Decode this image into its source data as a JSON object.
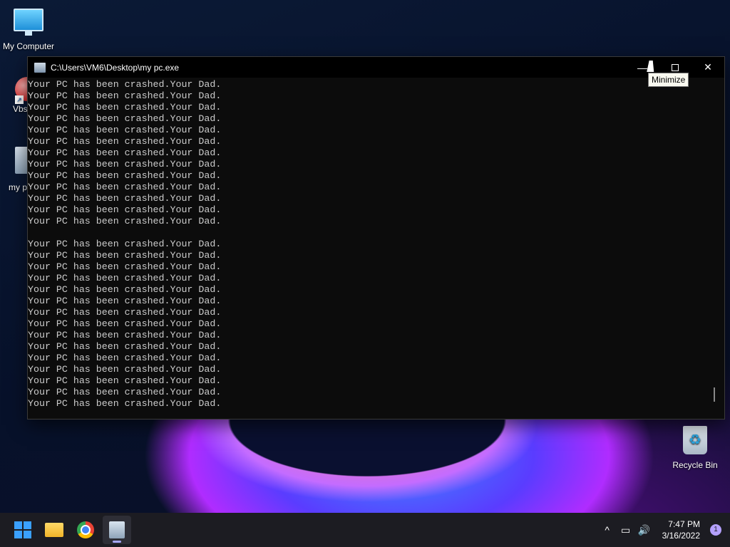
{
  "desktop": {
    "icons": [
      {
        "label": "My Computer",
        "icon": "monitor-icon"
      },
      {
        "label": "Vbs",
        "icon": "red-ball-shortcut-icon"
      },
      {
        "label": "my p",
        "icon": "pc-app-icon"
      },
      {
        "label": "Recycle Bin",
        "icon": "recycle-bin-icon"
      }
    ]
  },
  "console": {
    "title": "C:\\Users\\VM6\\Desktop\\my pc.exe",
    "text": "Your PC has been crashed.Your Dad.\nYour PC has been crashed.Your Dad.\nYour PC has been crashed.Your Dad.\nYour PC has been crashed.Your Dad.\nYour PC has been crashed.Your Dad.\nYour PC has been crashed.Your Dad.\nYour PC has been crashed.Your Dad.\nYour PC has been crashed.Your Dad.\nYour PC has been crashed.Your Dad.\nYour PC has been crashed.Your Dad.\nYour PC has been crashed.Your Dad.\nYour PC has been crashed.Your Dad.\nYour PC has been crashed.Your Dad.\n\nYour PC has been crashed.Your Dad.\nYour PC has been crashed.Your Dad.\nYour PC has been crashed.Your Dad.\nYour PC has been crashed.Your Dad.\nYour PC has been crashed.Your Dad.\nYour PC has been crashed.Your Dad.\nYour PC has been crashed.Your Dad.\nYour PC has been crashed.Your Dad.\nYour PC has been crashed.Your Dad.\nYour PC has been crashed.Your Dad.\nYour PC has been crashed.Your Dad.\nYour PC has been crashed.Your Dad.\nYour PC has been crashed.Your Dad.\nYour PC has been crashed.Your Dad.\nYour PC has been crashed.Your Dad.",
    "minimize_glyph": "—",
    "close_glyph": "✕",
    "tooltip": "Minimize"
  },
  "taskbar": {
    "apps": [
      "start-icon",
      "file-explorer-icon",
      "chrome-icon",
      "my-pc-app-icon"
    ],
    "tray": {
      "chevron": "^",
      "network": "▭",
      "volume": "🔊",
      "time": "7:47 PM",
      "date": "3/16/2022",
      "notification_count": "1"
    }
  },
  "colors": {
    "console_bg": "#0c0c0c",
    "console_text": "#cccccc",
    "taskbar_bg": "#1c1c22",
    "accent": "#3aa0ff"
  }
}
